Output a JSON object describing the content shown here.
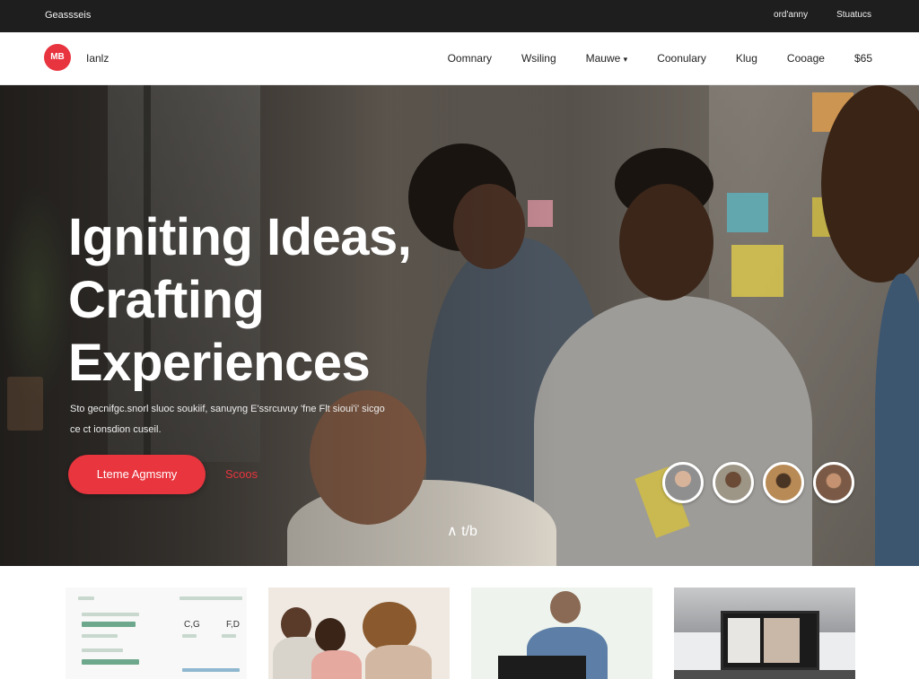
{
  "topbar": {
    "brand": "Geassseis",
    "links": [
      "ord'anny",
      "Stuatucs"
    ]
  },
  "navbar": {
    "logo_mark": "MB",
    "logo_text": "Ianlz",
    "items": [
      "Oomnary",
      "Wsiling",
      "Mauwe",
      "Coonulary",
      "Klug",
      "Cooage",
      "$65"
    ],
    "dropdown_glyph": "▾"
  },
  "hero": {
    "title_lines": [
      "Igniting Ideas,",
      "Crafting",
      "Experiences"
    ],
    "subtitle_lines": [
      "Sto gecnifgc.snorl sluoc soukiif, sanuyng E'ssrcuvuy 'fne Flt sioui'i' sicgo",
      "ce ct ionsdion cuseil."
    ],
    "cta_label": "Lteme Agmsmy",
    "secondary_label": "Scoos",
    "scroll_label": "∧ t/b",
    "accent_color": "#e8353e"
  },
  "thumbnails": {
    "t1": {
      "label_left": "C,G",
      "label_right": "F,D"
    }
  },
  "colors": {
    "topbar_bg": "#1e1e1e",
    "accent": "#e8353e"
  }
}
